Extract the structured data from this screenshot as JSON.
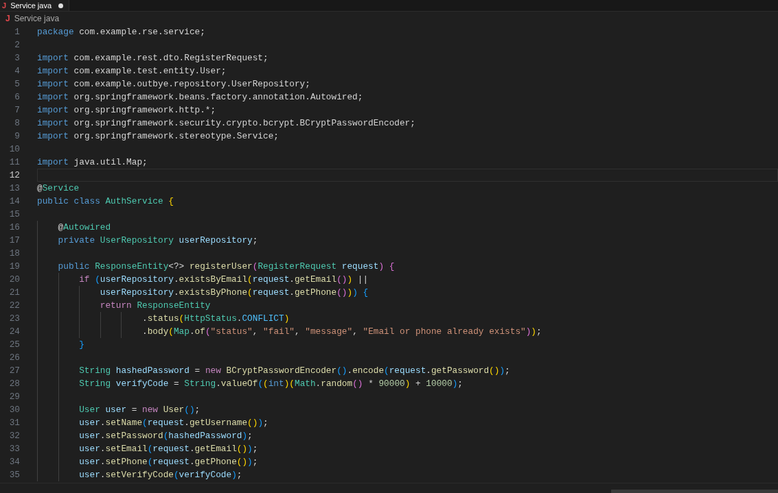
{
  "tabs": [
    {
      "file_icon": "J",
      "label": "Service java",
      "selected": true,
      "modified": true
    }
  ],
  "breadcrumb": {
    "file_icon": "J",
    "label": "Service java"
  },
  "lines": [
    {
      "number": "1",
      "current": false,
      "tokens": [
        {
          "kind": "kw",
          "text": "package"
        },
        {
          "kind": "plain",
          "text": " com.example.rse.service;"
        }
      ]
    },
    {
      "number": "2",
      "current": false
    },
    {
      "number": "3",
      "current": false,
      "tokens": [
        {
          "kind": "kw",
          "text": "import"
        },
        {
          "kind": "plain",
          "text": " com.example.rest.dto.RegisterRequest;"
        }
      ]
    },
    {
      "number": "4",
      "current": false,
      "tokens": [
        {
          "kind": "kw",
          "text": "import"
        },
        {
          "kind": "plain",
          "text": " com.example.test.entity.User;"
        }
      ]
    },
    {
      "number": "5",
      "current": false,
      "tokens": [
        {
          "kind": "kw",
          "text": "import"
        },
        {
          "kind": "plain",
          "text": " com.example.outbye.repository.UserRepository;"
        }
      ]
    },
    {
      "number": "6",
      "current": false,
      "tokens": [
        {
          "kind": "kw",
          "text": "import"
        },
        {
          "kind": "plain",
          "text": " org.springframework.beans.factory.annotation.Autowired;"
        }
      ]
    },
    {
      "number": "7",
      "current": false,
      "tokens": [
        {
          "kind": "kw",
          "text": "import"
        },
        {
          "kind": "plain",
          "text": " org.springframework.http.*;"
        }
      ]
    },
    {
      "number": "8",
      "current": false,
      "tokens": [
        {
          "kind": "kw",
          "text": "import"
        },
        {
          "kind": "plain",
          "text": " org.springframework.security.crypto.bcrypt.BCryptPasswordEncoder;"
        }
      ]
    },
    {
      "number": "9",
      "current": false,
      "tokens": [
        {
          "kind": "kw",
          "text": "import"
        },
        {
          "kind": "plain",
          "text": " org.springframework.stereotype.Service;"
        }
      ]
    },
    {
      "number": "10",
      "current": false
    },
    {
      "number": "11",
      "current": false,
      "tokens": [
        {
          "kind": "kw",
          "text": "import"
        },
        {
          "kind": "plain",
          "text": " java.util.Map;"
        }
      ]
    },
    {
      "number": "12",
      "current": true
    },
    {
      "number": "13",
      "current": false,
      "tokens": [
        {
          "kind": "plain",
          "text": "@"
        },
        {
          "kind": "type",
          "text": "Service"
        }
      ]
    },
    {
      "number": "14",
      "current": false,
      "tokens": [
        {
          "kind": "kw",
          "text": "public class "
        },
        {
          "kind": "type",
          "text": "AuthService "
        },
        {
          "kind": "b1",
          "text": "{"
        }
      ]
    },
    {
      "number": "15",
      "current": false
    },
    {
      "number": "16",
      "current": false,
      "tokens": [
        {
          "kind": "plain",
          "text": "    @"
        },
        {
          "kind": "type",
          "text": "Autowired"
        }
      ]
    },
    {
      "number": "17",
      "current": false,
      "tokens": [
        {
          "kind": "kw",
          "text": "    private "
        },
        {
          "kind": "type",
          "text": "UserRepository "
        },
        {
          "kind": "var",
          "text": "userRepository"
        },
        {
          "kind": "plain",
          "text": ";"
        }
      ]
    },
    {
      "number": "18",
      "current": false
    },
    {
      "number": "19",
      "current": false,
      "tokens": [
        {
          "kind": "kw",
          "text": "    public "
        },
        {
          "kind": "type",
          "text": "ResponseEntity"
        },
        {
          "kind": "plain",
          "text": "<?> "
        },
        {
          "kind": "fn",
          "text": "registerUser"
        },
        {
          "kind": "b2",
          "text": "("
        },
        {
          "kind": "type",
          "text": "RegisterRequest "
        },
        {
          "kind": "var",
          "text": "request"
        },
        {
          "kind": "b2",
          "text": ") {"
        }
      ]
    },
    {
      "number": "20",
      "current": false,
      "tokens": [
        {
          "kind": "ctrl",
          "text": "        if "
        },
        {
          "kind": "b3",
          "text": "("
        },
        {
          "kind": "var",
          "text": "userRepository"
        },
        {
          "kind": "plain",
          "text": "."
        },
        {
          "kind": "fn",
          "text": "existsByEmail"
        },
        {
          "kind": "b1",
          "text": "("
        },
        {
          "kind": "var",
          "text": "request"
        },
        {
          "kind": "plain",
          "text": "."
        },
        {
          "kind": "fn",
          "text": "getEmail"
        },
        {
          "kind": "b2",
          "text": "()"
        },
        {
          "kind": "b1",
          "text": ")"
        },
        {
          "kind": "plain",
          "text": " ||"
        }
      ]
    },
    {
      "number": "21",
      "current": false,
      "tokens": [
        {
          "kind": "var",
          "text": "            userRepository"
        },
        {
          "kind": "plain",
          "text": "."
        },
        {
          "kind": "fn",
          "text": "existsByPhone"
        },
        {
          "kind": "b1",
          "text": "("
        },
        {
          "kind": "var",
          "text": "request"
        },
        {
          "kind": "plain",
          "text": "."
        },
        {
          "kind": "fn",
          "text": "getPhone"
        },
        {
          "kind": "b2",
          "text": "()"
        },
        {
          "kind": "b1",
          "text": ")"
        },
        {
          "kind": "b3",
          "text": ") {"
        }
      ]
    },
    {
      "number": "22",
      "current": false,
      "tokens": [
        {
          "kind": "ctrl",
          "text": "            return "
        },
        {
          "kind": "type",
          "text": "ResponseEntity"
        }
      ]
    },
    {
      "number": "23",
      "current": false,
      "tokens": [
        {
          "kind": "plain",
          "text": "                    ."
        },
        {
          "kind": "fn",
          "text": "status"
        },
        {
          "kind": "b1",
          "text": "("
        },
        {
          "kind": "type",
          "text": "HttpStatus"
        },
        {
          "kind": "plain",
          "text": "."
        },
        {
          "kind": "const",
          "text": "CONFLICT"
        },
        {
          "kind": "b1",
          "text": ")"
        }
      ]
    },
    {
      "number": "24",
      "current": false,
      "tokens": [
        {
          "kind": "plain",
          "text": "                    ."
        },
        {
          "kind": "fn",
          "text": "body"
        },
        {
          "kind": "b1",
          "text": "("
        },
        {
          "kind": "type",
          "text": "Map"
        },
        {
          "kind": "plain",
          "text": "."
        },
        {
          "kind": "fn",
          "text": "of"
        },
        {
          "kind": "b2",
          "text": "("
        },
        {
          "kind": "str",
          "text": "\"status\""
        },
        {
          "kind": "plain",
          "text": ", "
        },
        {
          "kind": "str",
          "text": "\"fail\""
        },
        {
          "kind": "plain",
          "text": ", "
        },
        {
          "kind": "str",
          "text": "\"message\""
        },
        {
          "kind": "plain",
          "text": ", "
        },
        {
          "kind": "str",
          "text": "\"Email or phone already exists\""
        },
        {
          "kind": "b2",
          "text": ")"
        },
        {
          "kind": "b1",
          "text": ")"
        },
        {
          "kind": "plain",
          "text": ";"
        }
      ]
    },
    {
      "number": "25",
      "current": false,
      "tokens": [
        {
          "kind": "b3",
          "text": "        }"
        }
      ]
    },
    {
      "number": "26",
      "current": false
    },
    {
      "number": "27",
      "current": false,
      "tokens": [
        {
          "kind": "type",
          "text": "        String "
        },
        {
          "kind": "var",
          "text": "hashedPassword"
        },
        {
          "kind": "plain",
          "text": " = "
        },
        {
          "kind": "ctrl",
          "text": "new "
        },
        {
          "kind": "fn",
          "text": "BCryptPasswordEncoder"
        },
        {
          "kind": "b3",
          "text": "()"
        },
        {
          "kind": "plain",
          "text": "."
        },
        {
          "kind": "fn",
          "text": "encode"
        },
        {
          "kind": "b3",
          "text": "("
        },
        {
          "kind": "var",
          "text": "request"
        },
        {
          "kind": "plain",
          "text": "."
        },
        {
          "kind": "fn",
          "text": "getPassword"
        },
        {
          "kind": "b1",
          "text": "()"
        },
        {
          "kind": "b3",
          "text": ")"
        },
        {
          "kind": "plain",
          "text": ";"
        }
      ]
    },
    {
      "number": "28",
      "current": false,
      "tokens": [
        {
          "kind": "type",
          "text": "        String "
        },
        {
          "kind": "var",
          "text": "verifyCode"
        },
        {
          "kind": "plain",
          "text": " = "
        },
        {
          "kind": "type",
          "text": "String"
        },
        {
          "kind": "plain",
          "text": "."
        },
        {
          "kind": "fn",
          "text": "valueOf"
        },
        {
          "kind": "b3",
          "text": "("
        },
        {
          "kind": "b1",
          "text": "("
        },
        {
          "kind": "kw",
          "text": "int"
        },
        {
          "kind": "b1",
          "text": ")("
        },
        {
          "kind": "type",
          "text": "Math"
        },
        {
          "kind": "plain",
          "text": "."
        },
        {
          "kind": "fn",
          "text": "random"
        },
        {
          "kind": "b2",
          "text": "()"
        },
        {
          "kind": "plain",
          "text": " * "
        },
        {
          "kind": "num",
          "text": "90000"
        },
        {
          "kind": "b1",
          "text": ")"
        },
        {
          "kind": "plain",
          "text": " + "
        },
        {
          "kind": "num",
          "text": "10000"
        },
        {
          "kind": "b3",
          "text": ")"
        },
        {
          "kind": "plain",
          "text": ";"
        }
      ]
    },
    {
      "number": "29",
      "current": false
    },
    {
      "number": "30",
      "current": false,
      "tokens": [
        {
          "kind": "type",
          "text": "        User "
        },
        {
          "kind": "var",
          "text": "user"
        },
        {
          "kind": "plain",
          "text": " = "
        },
        {
          "kind": "ctrl",
          "text": "new "
        },
        {
          "kind": "fn",
          "text": "User"
        },
        {
          "kind": "b3",
          "text": "()"
        },
        {
          "kind": "plain",
          "text": ";"
        }
      ]
    },
    {
      "number": "31",
      "current": false,
      "tokens": [
        {
          "kind": "var",
          "text": "        user"
        },
        {
          "kind": "plain",
          "text": "."
        },
        {
          "kind": "fn",
          "text": "setName"
        },
        {
          "kind": "b3",
          "text": "("
        },
        {
          "kind": "var",
          "text": "request"
        },
        {
          "kind": "plain",
          "text": "."
        },
        {
          "kind": "fn",
          "text": "getUsername"
        },
        {
          "kind": "b1",
          "text": "()"
        },
        {
          "kind": "b3",
          "text": ")"
        },
        {
          "kind": "plain",
          "text": ";"
        }
      ]
    },
    {
      "number": "32",
      "current": false,
      "tokens": [
        {
          "kind": "var",
          "text": "        user"
        },
        {
          "kind": "plain",
          "text": "."
        },
        {
          "kind": "fn",
          "text": "setPassword"
        },
        {
          "kind": "b3",
          "text": "("
        },
        {
          "kind": "var",
          "text": "hashedPassword"
        },
        {
          "kind": "b3",
          "text": ")"
        },
        {
          "kind": "plain",
          "text": ";"
        }
      ]
    },
    {
      "number": "33",
      "current": false,
      "tokens": [
        {
          "kind": "var",
          "text": "        user"
        },
        {
          "kind": "plain",
          "text": "."
        },
        {
          "kind": "fn",
          "text": "setEmail"
        },
        {
          "kind": "b3",
          "text": "("
        },
        {
          "kind": "var",
          "text": "request"
        },
        {
          "kind": "plain",
          "text": "."
        },
        {
          "kind": "fn",
          "text": "getEmail"
        },
        {
          "kind": "b1",
          "text": "()"
        },
        {
          "kind": "b3",
          "text": ")"
        },
        {
          "kind": "plain",
          "text": ";"
        }
      ]
    },
    {
      "number": "34",
      "current": false,
      "tokens": [
        {
          "kind": "var",
          "text": "        user"
        },
        {
          "kind": "plain",
          "text": "."
        },
        {
          "kind": "fn",
          "text": "setPhone"
        },
        {
          "kind": "b3",
          "text": "("
        },
        {
          "kind": "var",
          "text": "request"
        },
        {
          "kind": "plain",
          "text": "."
        },
        {
          "kind": "fn",
          "text": "getPhone"
        },
        {
          "kind": "b1",
          "text": "()"
        },
        {
          "kind": "b3",
          "text": ")"
        },
        {
          "kind": "plain",
          "text": ";"
        }
      ]
    },
    {
      "number": "35",
      "current": false,
      "tokens": [
        {
          "kind": "var",
          "text": "        user"
        },
        {
          "kind": "plain",
          "text": "."
        },
        {
          "kind": "fn",
          "text": "setVerifyCode"
        },
        {
          "kind": "b3",
          "text": "("
        },
        {
          "kind": "var",
          "text": "verifyCode"
        },
        {
          "kind": "b3",
          "text": ")"
        },
        {
          "kind": "plain",
          "text": ";"
        }
      ]
    }
  ]
}
